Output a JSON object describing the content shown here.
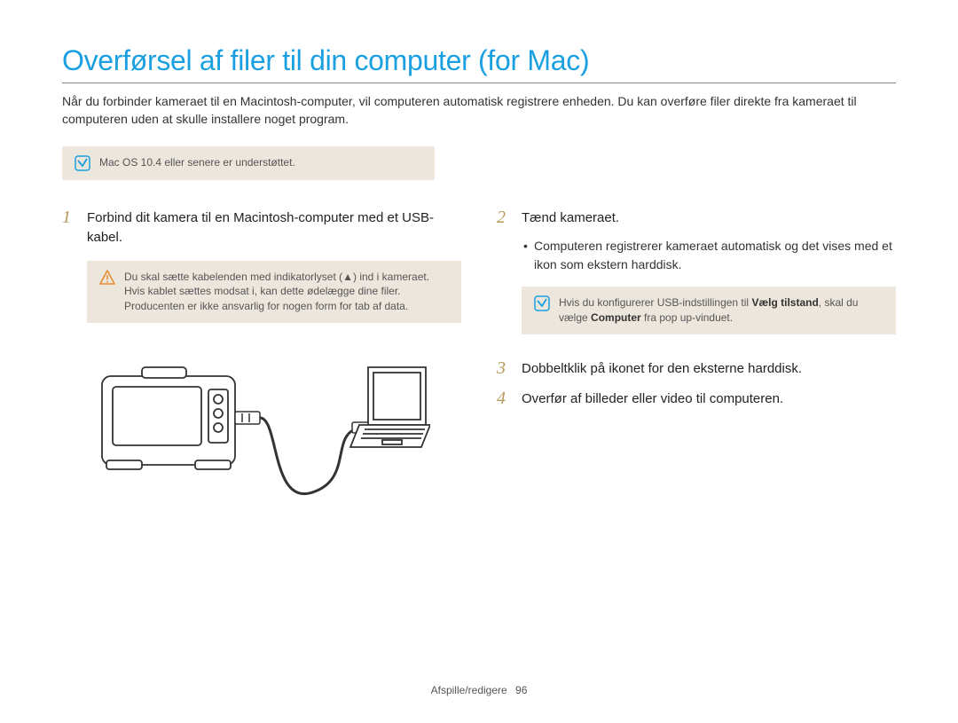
{
  "title": "Overførsel af filer til din computer (for Mac)",
  "intro": "Når du forbinder kameraet til en Macintosh-computer, vil computeren automatisk registrere enheden. Du kan overføre filer direkte fra kameraet til computeren uden at skulle installere noget program.",
  "top_note": "Mac OS 10.4 eller senere er understøttet.",
  "left": {
    "step1_num": "1",
    "step1_text": "Forbind dit kamera til en Macintosh-computer med et USB-kabel.",
    "warning": "Du skal sætte kabelenden med indikatorlyset (▲) ind i kameraet. Hvis kablet sættes modsat i, kan dette ødelægge dine filer. Producenten er ikke ansvarlig for nogen form for tab af data."
  },
  "right": {
    "step2_num": "2",
    "step2_text": "Tænd kameraet.",
    "bullet": "Computeren registrerer kameraet automatisk og det vises med et ikon som ekstern harddisk.",
    "note_pre": "Hvis du konfigurerer USB-indstillingen til ",
    "note_bold1": "Vælg tilstand",
    "note_mid": ", skal du vælge ",
    "note_bold2": "Computer",
    "note_post": " fra pop up-vinduet.",
    "step3_num": "3",
    "step3_text": "Dobbeltklik på ikonet for den eksterne harddisk.",
    "step4_num": "4",
    "step4_text": "Overfør af billeder eller video til computeren."
  },
  "footer_label": "Afspille/redigere",
  "footer_page": "96"
}
